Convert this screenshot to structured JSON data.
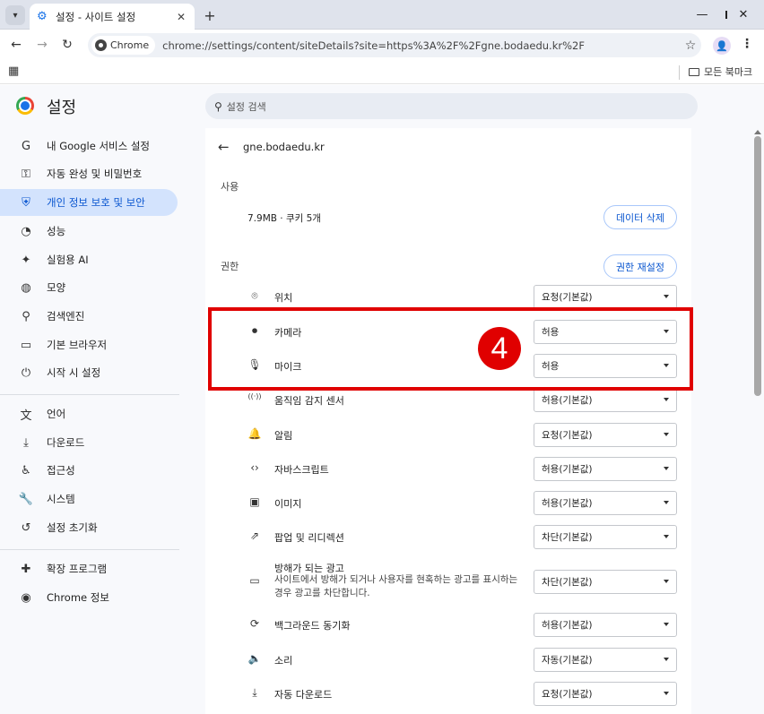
{
  "tab": {
    "title": "설정 - 사이트 설정"
  },
  "omnibox": {
    "chip": "Chrome",
    "url": "chrome://settings/content/siteDetails?site=https%3A%2F%2Fgne.bodaedu.kr%2F"
  },
  "bookmarks": {
    "all_label": "모든 북마크"
  },
  "header": {
    "title": "설정",
    "search_placeholder": "설정 검색"
  },
  "nav": [
    {
      "label": "내 Google 서비스 설정",
      "icon": "google-g-icon",
      "glyph": "G"
    },
    {
      "label": "자동 완성 및 비밀번호",
      "icon": "key-icon",
      "glyph": "⚿"
    },
    {
      "label": "개인 정보 보호 및 보안",
      "icon": "shield-icon",
      "glyph": "⛨",
      "active": true
    },
    {
      "label": "성능",
      "icon": "speedometer-icon",
      "glyph": "◔"
    },
    {
      "label": "실험용 AI",
      "icon": "sparkle-icon",
      "glyph": "✦"
    },
    {
      "label": "모양",
      "icon": "palette-icon",
      "glyph": "◍"
    },
    {
      "label": "검색엔진",
      "icon": "search-icon",
      "glyph": "⚲"
    },
    {
      "label": "기본 브라우저",
      "icon": "browser-window-icon",
      "glyph": "▭"
    },
    {
      "label": "시작 시 설정",
      "icon": "power-icon",
      "glyph": "⏻"
    },
    {
      "label": "언어",
      "icon": "translate-icon",
      "glyph": "文"
    },
    {
      "label": "다운로드",
      "icon": "download-icon",
      "glyph": "⤓"
    },
    {
      "label": "접근성",
      "icon": "accessibility-icon",
      "glyph": "♿"
    },
    {
      "label": "시스템",
      "icon": "wrench-icon",
      "glyph": "🔧"
    },
    {
      "label": "설정 초기화",
      "icon": "reset-icon",
      "glyph": "↺"
    },
    {
      "label": "확장 프로그램",
      "icon": "puzzle-icon",
      "glyph": "✚"
    },
    {
      "label": "Chrome 정보",
      "icon": "chrome-icon",
      "glyph": "◉"
    }
  ],
  "site": {
    "name": "gne.bodaedu.kr",
    "usage_heading": "사용",
    "usage_text": "7.9MB · 쿠키 5개",
    "delete_data_label": "데이터 삭제",
    "permissions_heading": "권한",
    "reset_permissions_label": "권한 재설정"
  },
  "permissions": [
    {
      "label": "위치",
      "icon": "location-pin-icon",
      "glyph": "⌾",
      "value": "요청(기본값)"
    },
    {
      "label": "카메라",
      "icon": "camera-icon",
      "glyph": "⏺",
      "value": "허용"
    },
    {
      "label": "마이크",
      "icon": "microphone-icon",
      "glyph": "🎙",
      "value": "허용"
    },
    {
      "label": "움직임 감지 센서",
      "icon": "motion-sensor-icon",
      "glyph": "((·))",
      "value": "허용(기본값)"
    },
    {
      "label": "알림",
      "icon": "bell-icon",
      "glyph": "🔔",
      "value": "요청(기본값)"
    },
    {
      "label": "자바스크립트",
      "icon": "code-icon",
      "glyph": "‹›",
      "value": "허용(기본값)"
    },
    {
      "label": "이미지",
      "icon": "image-icon",
      "glyph": "▣",
      "value": "허용(기본값)"
    },
    {
      "label": "팝업 및 리디렉션",
      "icon": "external-link-icon",
      "glyph": "⇗",
      "value": "차단(기본값)"
    },
    {
      "label": "방해가 되는 광고",
      "icon": "ad-window-icon",
      "glyph": "▭",
      "value": "차단(기본값)",
      "description": "사이트에서 방해가 되거나 사용자를 현혹하는 광고를 표시하는 경우 광고를 차단합니다."
    },
    {
      "label": "백그라운드 동기화",
      "icon": "sync-icon",
      "glyph": "⟳",
      "value": "허용(기본값)"
    },
    {
      "label": "소리",
      "icon": "speaker-icon",
      "glyph": "🔈",
      "value": "자동(기본값)"
    },
    {
      "label": "자동 다운로드",
      "icon": "download-icon",
      "glyph": "⤓",
      "value": "요청(기본값)"
    }
  ],
  "annotation": {
    "badge": "4"
  }
}
